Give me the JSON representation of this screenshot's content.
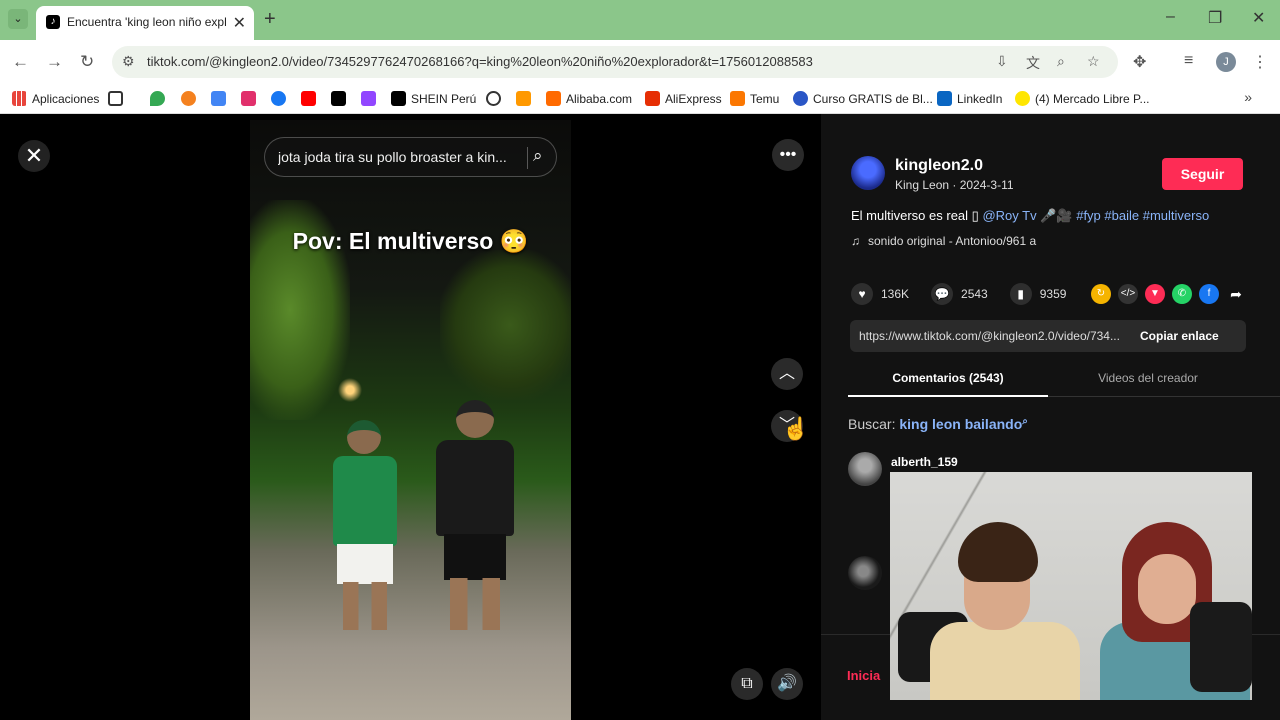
{
  "browser": {
    "tab_title": "Encuentra 'king leon niño explo",
    "url": "tiktok.com/@kingleon2.0/video/7345297762470268166?q=king%20leon%20niño%20explorador&t=1756012088583"
  },
  "bookmarks": [
    {
      "label": "Aplicaciones",
      "color": "#e8453c"
    },
    {
      "label": "",
      "color": "#333333"
    },
    {
      "label": "",
      "color": "#34a853"
    },
    {
      "label": "",
      "color": "#f4811f"
    },
    {
      "label": "",
      "color": "#4285f4"
    },
    {
      "label": "",
      "color": "#e1306c"
    },
    {
      "label": "",
      "color": "#1877f2"
    },
    {
      "label": "",
      "color": "#ff0000"
    },
    {
      "label": "",
      "color": "#000000"
    },
    {
      "label": "",
      "color": "#9146ff"
    },
    {
      "label": "SHEIN Perú",
      "color": "#000000"
    },
    {
      "label": "",
      "color": "#333333"
    },
    {
      "label": "",
      "color": "#ff9900"
    },
    {
      "label": "Alibaba.com",
      "color": "#ff6a00"
    },
    {
      "label": "AliExpress",
      "color": "#e62e04"
    },
    {
      "label": "Temu",
      "color": "#fb7701"
    },
    {
      "label": "Curso GRATIS de Bl...",
      "color": "#2a56c6"
    },
    {
      "label": "LinkedIn",
      "color": "#0a66c2"
    },
    {
      "label": "(4) Mercado Libre P...",
      "color": "#ffe600"
    }
  ],
  "video": {
    "search_text": "jota joda tira su pollo broaster a kin...",
    "caption": "Pov: El multiverso 😳"
  },
  "panel": {
    "username": "kingleon2.0",
    "subtitle": "King Leon · 2024-3-11",
    "follow_label": "Seguir",
    "desc_text": "El multiverso es real",
    "desc_box": "▯",
    "desc_mention": "@Roy Tv",
    "desc_emojis": "🎤🎥",
    "desc_tags": "#fyp #baile #multiverso",
    "music": "sonido original - Antonioo/961 a",
    "likes": "136K",
    "comments": "2543",
    "saves": "9359",
    "link": "https://www.tiktok.com/@kingleon2.0/video/734...",
    "copy_label": "Copiar enlace",
    "tab_comments": "Comentarios (2543)",
    "tab_videos": "Videos del creador",
    "search_prefix": "Buscar:",
    "search_keyword": "king leon bailando",
    "search_icon": "⌕",
    "comment_user": "alberth_159",
    "login_label": "Inicia"
  }
}
